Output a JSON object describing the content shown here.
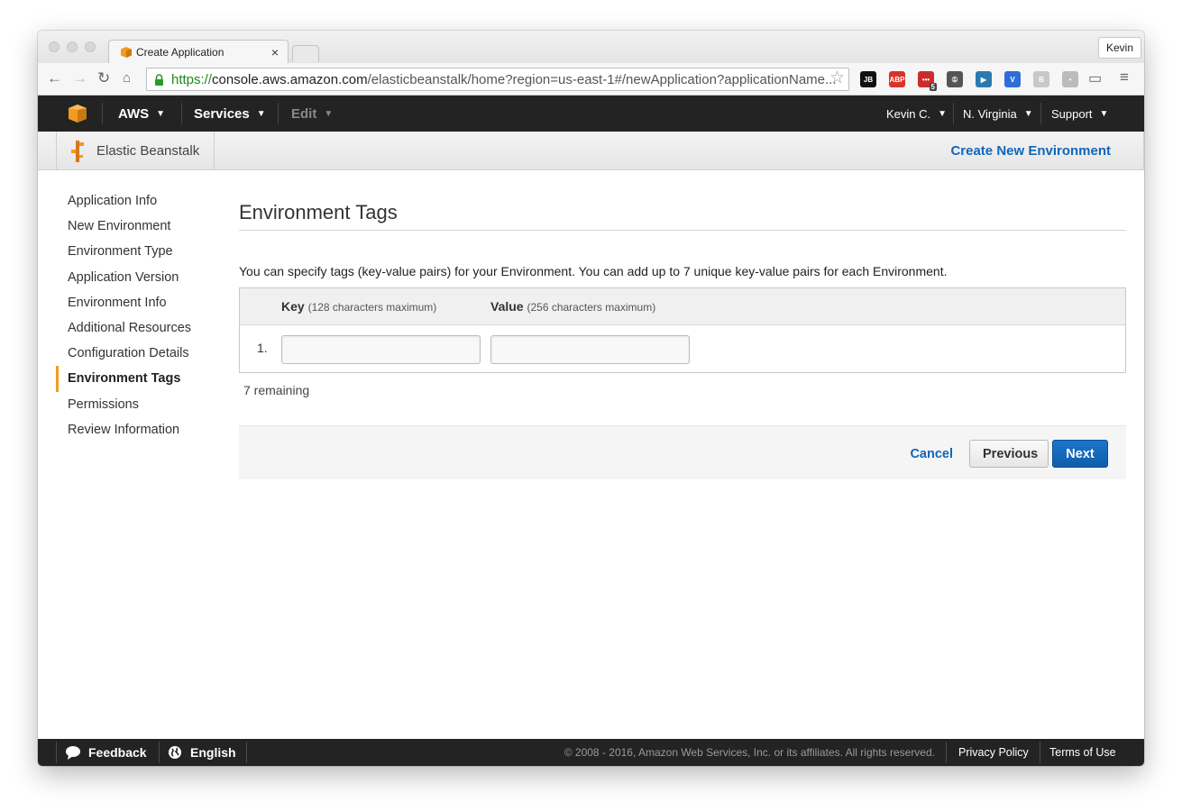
{
  "browser": {
    "tab_title": "Create Application",
    "tab_close": "×",
    "profile_name": "Kevin",
    "url_scheme": "https://",
    "url_host": "console.aws.amazon.com",
    "url_path": "/elasticbeanstalk/home?region=us-east-1#/newApplication?applicationName...",
    "extensions": [
      {
        "name": "jetbrains-icon",
        "label": "JB",
        "color": "#111111"
      },
      {
        "name": "adblock-icon",
        "label": "ABP",
        "color": "#d9342b"
      },
      {
        "name": "lastpass-icon",
        "label": "•••",
        "color": "#cc2c2c",
        "badge": "5"
      },
      {
        "name": "onepassword-icon",
        "label": "①",
        "color": "#555555"
      },
      {
        "name": "play-icon",
        "label": "▶",
        "color": "#2a7ab0"
      },
      {
        "name": "vimeo-icon",
        "label": "V",
        "color": "#2d6fd6"
      },
      {
        "name": "bookmark-icon",
        "label": "B",
        "color": "#c8c8c8"
      },
      {
        "name": "circle-icon",
        "label": "•",
        "color": "#bbbbbb"
      }
    ]
  },
  "awsnav": {
    "aws_label": "AWS",
    "services_label": "Services",
    "edit_label": "Edit",
    "user_label": "Kevin C.",
    "region_label": "N. Virginia",
    "support_label": "Support"
  },
  "service_bar": {
    "service_name": "Elastic Beanstalk",
    "create_env_label": "Create New Environment"
  },
  "sidenav": {
    "items": [
      {
        "label": "Application Info",
        "active": false
      },
      {
        "label": "New Environment",
        "active": false
      },
      {
        "label": "Environment Type",
        "active": false
      },
      {
        "label": "Application Version",
        "active": false
      },
      {
        "label": "Environment Info",
        "active": false
      },
      {
        "label": "Additional Resources",
        "active": false
      },
      {
        "label": "Configuration Details",
        "active": false
      },
      {
        "label": "Environment Tags",
        "active": true
      },
      {
        "label": "Permissions",
        "active": false
      },
      {
        "label": "Review Information",
        "active": false
      }
    ]
  },
  "main": {
    "title": "Environment Tags",
    "description": "You can specify tags (key-value pairs) for your Environment. You can add up to 7 unique key-value pairs for each Environment.",
    "key_header": "Key",
    "key_hint": "(128 characters maximum)",
    "value_header": "Value",
    "value_hint": "(256 characters maximum)",
    "row_number": "1.",
    "key_value": "",
    "value_value": "",
    "remaining": "7 remaining",
    "cancel_label": "Cancel",
    "previous_label": "Previous",
    "next_label": "Next"
  },
  "footer": {
    "feedback_label": "Feedback",
    "language_label": "English",
    "copyright": "© 2008 - 2016, Amazon Web Services, Inc. or its affiliates. All rights reserved.",
    "privacy_label": "Privacy Policy",
    "terms_label": "Terms of Use"
  },
  "colors": {
    "aws_nav_bg": "#232323",
    "link_blue": "#1166bb",
    "primary_button": "#1166bb",
    "active_marker": "#f29c1f"
  }
}
